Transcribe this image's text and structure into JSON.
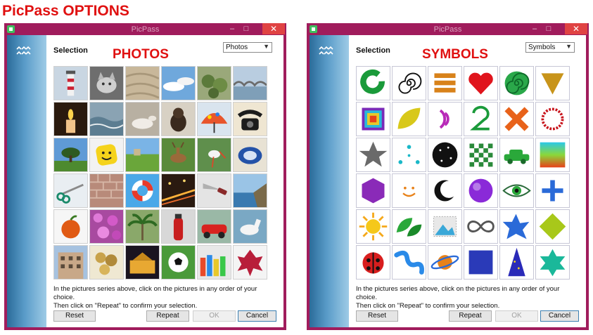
{
  "heading": "PicPass OPTIONS",
  "windows": [
    {
      "title": "PicPass",
      "close_glyph": "✕",
      "min_glyph": "–",
      "max_glyph": "□",
      "selection_label": "Selection",
      "category_label": "PHOTOS",
      "dropdown_value": "Photos",
      "dropdown_arrow": "▼",
      "instructions_line1": "In the pictures series above, click on the pictures in any order of your choice.",
      "instructions_line2": "Then click on \"Repeat\" to confirm your selection.",
      "buttons": {
        "reset": "Reset",
        "repeat": "Repeat",
        "ok": "OK",
        "cancel": "Cancel"
      },
      "cells": [
        "lighthouse-photo",
        "cat-photo",
        "sand-photo",
        "sky-clouds-photo",
        "cactus-photo",
        "bridge-photo",
        "candle-photo",
        "sea-waves-photo",
        "horse-lying-photo",
        "monkey-photo",
        "umbrella-photo",
        "telephone-photo",
        "tree-field-photo",
        "smiley-ball-photo",
        "meadow-photo",
        "deer-photo",
        "stork-photo",
        "plate-photo",
        "scissors-photo",
        "brick-wall-photo",
        "lifebuoy-photo",
        "city-lights-photo",
        "knife-photo",
        "coast-photo",
        "apple-photo",
        "flowers-photo",
        "palm-tree-photo",
        "fire-extinguisher-photo",
        "red-car-photo",
        "white-horse-photo",
        "building-photo",
        "coins-photo",
        "palace-night-photo",
        "football-photo",
        "colorful-stalls-photo",
        "red-leaves-photo"
      ]
    },
    {
      "title": "PicPass",
      "close_glyph": "✕",
      "min_glyph": "–",
      "max_glyph": "□",
      "selection_label": "Selection",
      "category_label": "SYMBOLS",
      "dropdown_value": "Symbols",
      "dropdown_arrow": "▼",
      "instructions_line1": "In the pictures series above, click on the pictures in any order of your choice.",
      "instructions_line2": "Then click on \"Repeat\" to confirm your selection.",
      "buttons": {
        "reset": "Reset",
        "repeat": "Repeat",
        "ok": "OK",
        "cancel": "Cancel"
      },
      "cells": [
        "green-ring-symbol",
        "spiral-symbol",
        "stripes-symbol",
        "heart-symbol",
        "green-spiral-symbol",
        "triangle-symbol",
        "squares-logo-symbol",
        "leaf-shape-symbol",
        "waves-symbol",
        "number-two-symbol",
        "cross-symbol",
        "ring-dots-symbol",
        "star-symbol",
        "dots-symbol",
        "night-sky-symbol",
        "checker-symbol",
        "car-symbol",
        "gradient-square-symbol",
        "hexagon-symbol",
        "smile-symbol",
        "moon-symbol",
        "purple-ball-symbol",
        "eye-symbol",
        "plus-symbol",
        "sun-symbol",
        "leaves-symbol",
        "stamp-symbol",
        "infinity-symbol",
        "blue-star-symbol",
        "diamond-symbol",
        "ladybug-symbol",
        "snake-symbol",
        "planet-symbol",
        "blue-square-symbol",
        "wizard-hat-symbol",
        "teal-star-symbol"
      ]
    }
  ],
  "colors": {
    "frame": "#a01c5c",
    "accent_red": "#e01010",
    "close": "#e04343",
    "sidebar": "#2b6c9a"
  }
}
